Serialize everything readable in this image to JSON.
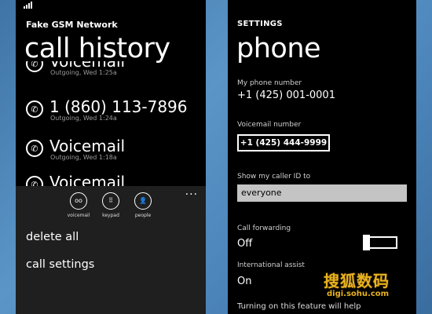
{
  "left_screen": {
    "network_name": "Fake GSM Network",
    "title": "call history",
    "calls": [
      {
        "name": "Voicemail",
        "detail": "Outgoing, Wed 1:25a"
      },
      {
        "name": "1 (860) 113-7896",
        "detail": "Outgoing, Wed 1:24a"
      },
      {
        "name": "Voicemail",
        "detail": "Outgoing, Wed 1:18a"
      },
      {
        "name": "Voicemail",
        "detail": ""
      }
    ],
    "app_bar": {
      "more": "...",
      "buttons": [
        {
          "label": "voicemail",
          "icon": "voicemail-icon",
          "glyph": "oo"
        },
        {
          "label": "keypad",
          "icon": "keypad-icon",
          "glyph": "⠿"
        },
        {
          "label": "people",
          "icon": "people-icon",
          "glyph": "👤"
        }
      ],
      "menu": [
        "delete all",
        "call settings"
      ]
    }
  },
  "right_screen": {
    "section": "SETTINGS",
    "title": "phone",
    "my_number_label": "My phone number",
    "my_number": "+1 (425) 001-0001",
    "voicemail_label": "Voicemail number",
    "voicemail_number": "+1 (425) 444-9999",
    "caller_id_label": "Show my caller ID to",
    "caller_id_value": "everyone",
    "forwarding_label": "Call forwarding",
    "forwarding_value": "Off",
    "intl_assist_label": "International assist",
    "intl_assist_value": "On",
    "intl_assist_note": "Turning on this feature will help"
  },
  "watermark": {
    "main": "搜狐数码",
    "sub": "digi.sohu.com"
  },
  "colors": {
    "background": "#4a84b6",
    "phone_bg": "#000000",
    "app_bar_bg": "#1f1f1f",
    "watermark": "#e8b21f"
  }
}
